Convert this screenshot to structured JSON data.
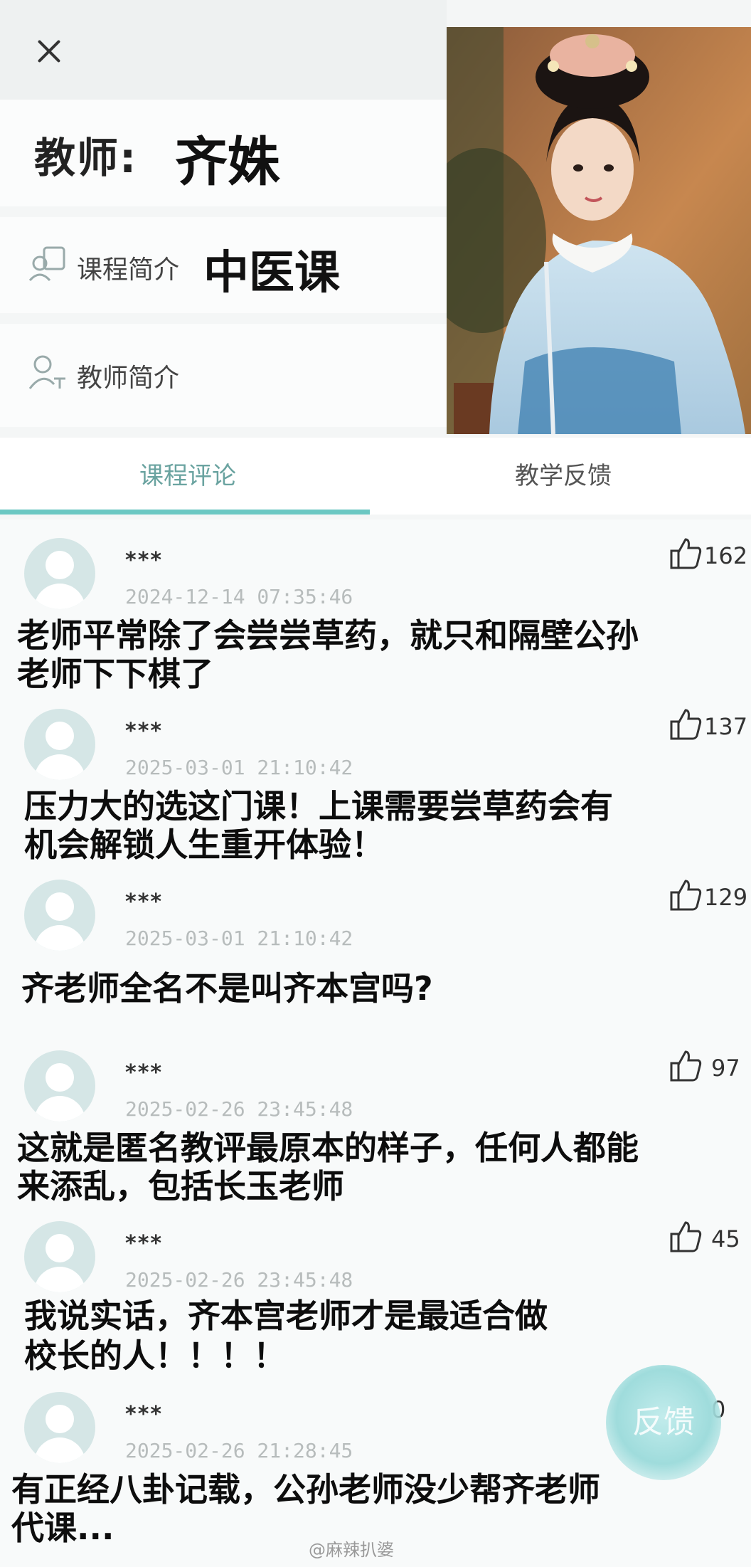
{
  "header": {
    "teacher_label": "教师:",
    "teacher_name": "齐姝",
    "course_label": "课程简介",
    "course_name": "中医课",
    "intro_label": "教师简介"
  },
  "tabs": [
    {
      "label": "课程评论",
      "active": true
    },
    {
      "label": "教学反馈",
      "active": false
    }
  ],
  "comments": [
    {
      "user": "***",
      "time": "2024-12-14 07:35:46",
      "likes": "162",
      "line1": "老师平常除了会尝尝草药，就只和隔壁公孙",
      "line2": "老师下下棋了"
    },
    {
      "user": "***",
      "time": "2025-03-01 21:10:42",
      "likes": "137",
      "line1": "压力大的选这门课！上课需要尝草药会有",
      "line2": "机会解锁人生重开体验！"
    },
    {
      "user": "***",
      "time": "2025-03-01 21:10:42",
      "likes": "129",
      "line1": "齐老师全名不是叫齐本宫吗?",
      "line2": ""
    },
    {
      "user": "***",
      "time": "2025-02-26 23:45:48",
      "likes": "97",
      "line1": "这就是匿名教评最原本的样子，任何人都能",
      "line2": "来添乱，包括长玉老师"
    },
    {
      "user": "***",
      "time": "2025-02-26 23:45:48",
      "likes": "45",
      "line1": "我说实话，齐本宫老师才是最适合做",
      "line2": "校长的人！！！！"
    },
    {
      "user": "***",
      "time": "2025-02-26 21:28:45",
      "likes": "0",
      "line1": "有正经八卦记载，公孙老师没少帮齐老师",
      "line2": "代课..."
    }
  ],
  "feedback_button": "反馈",
  "watermark": "@麻辣扒婆",
  "colors": {
    "accent": "#6bc7c2",
    "tab_active_text": "#6aa3a0"
  },
  "icons": [
    "close-icon",
    "course-intro-icon",
    "teacher-intro-icon",
    "thumbs-up-icon",
    "user-avatar-icon"
  ]
}
